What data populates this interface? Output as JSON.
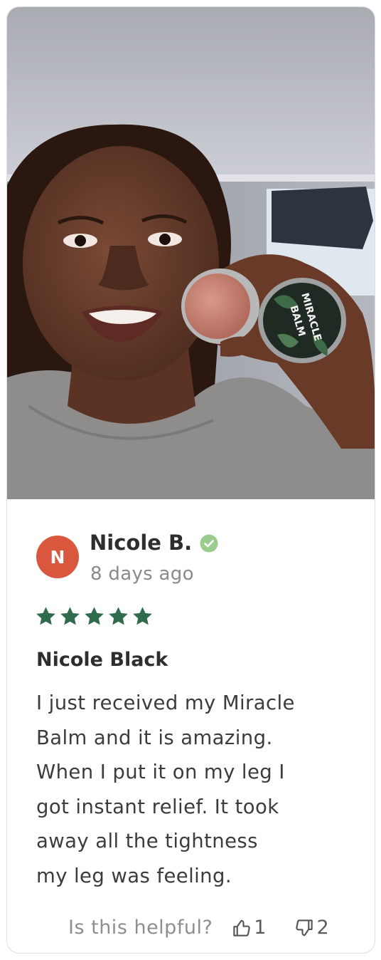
{
  "review": {
    "photo_alt": "Customer photo",
    "author": {
      "initial": "N",
      "name": "Nicole B.",
      "verified_icon": "check-circle-icon",
      "date": "8 days ago"
    },
    "rating": {
      "stars": 5,
      "out_of": 5
    },
    "title": "Nicole Black",
    "text_lines": [
      "I just received my Miracle",
      "Balm and it is amazing.",
      "When I put it on my leg I",
      "got instant relief. It took",
      "away all the tightness",
      "my leg was feeling."
    ],
    "helpful": {
      "label": "Is this helpful?",
      "up_icon": "thumbs-up-icon",
      "up_count": "1",
      "down_icon": "thumbs-down-icon",
      "down_count": "2"
    }
  },
  "product_label": {
    "line1": "MIRACLE",
    "line2": "BALM"
  },
  "colors": {
    "avatar": "#d9573c",
    "star": "#2f6b4c",
    "verified": "#9ccb8e",
    "text": "#3c3c3c",
    "muted": "#8a8a8a",
    "border": "#dedede"
  }
}
